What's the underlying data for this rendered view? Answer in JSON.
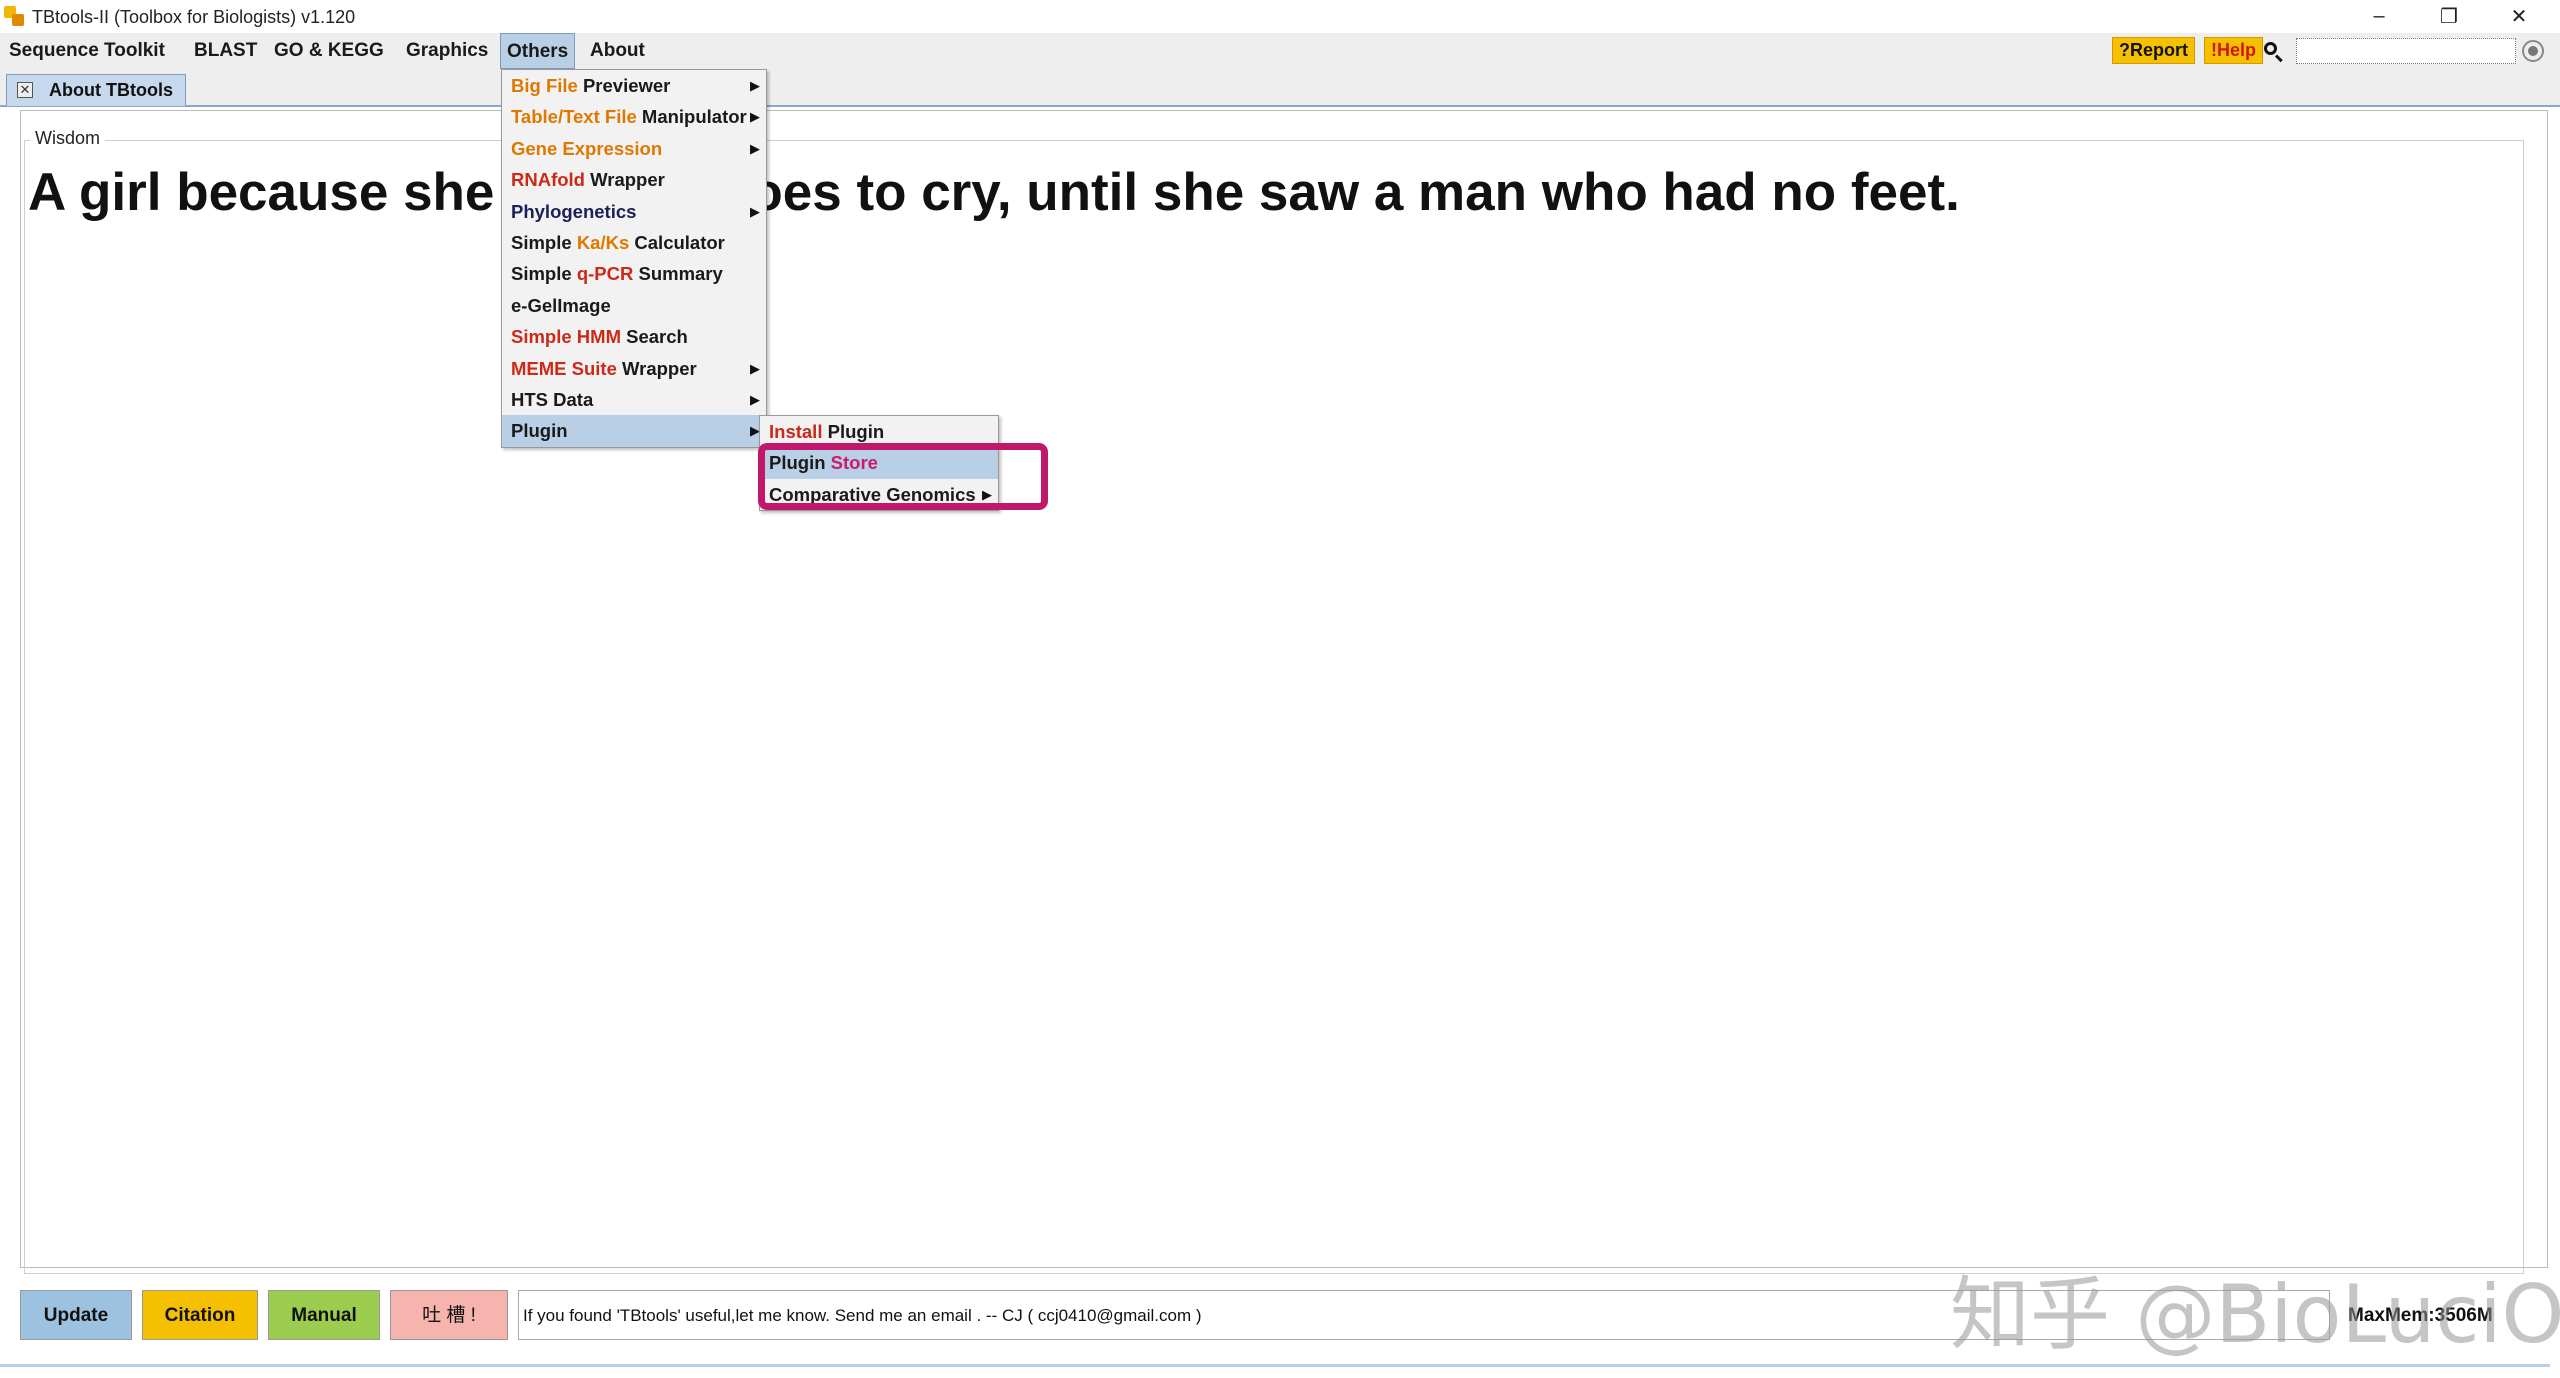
{
  "window": {
    "title": "TBtools-II (Toolbox for Biologists) v1.120",
    "controls": {
      "minimize": "–",
      "restore": "❐",
      "close": "✕"
    }
  },
  "menubar": {
    "items": [
      "Sequence Toolkit",
      "BLAST",
      "GO & KEGG",
      "Graphics",
      "Others",
      "About"
    ],
    "report_label": "?Report",
    "help_label": "!Help",
    "search_value": ""
  },
  "tab": {
    "label": "About TBtools",
    "close_glyph": "✕"
  },
  "wisdom": {
    "legend": "Wisdom",
    "quote_left": "A girl because she",
    "quote_right": "oes to cry, until she saw a man who had no feet."
  },
  "others_menu": {
    "items": [
      {
        "parts": [
          [
            "Big File",
            "orange"
          ],
          [
            " Previewer",
            ""
          ]
        ],
        "submenu": true
      },
      {
        "parts": [
          [
            "Table/Text File",
            "orange"
          ],
          [
            " Manipulator",
            ""
          ]
        ],
        "submenu": true
      },
      {
        "parts": [
          [
            "Gene Expression",
            "orange"
          ]
        ],
        "submenu": true
      },
      {
        "parts": [
          [
            "RNAfold",
            "red"
          ],
          [
            " Wrapper",
            ""
          ]
        ],
        "submenu": false
      },
      {
        "parts": [
          [
            "Phylogenetics",
            "dark"
          ]
        ],
        "submenu": true
      },
      {
        "parts": [
          [
            "Simple ",
            ""
          ],
          [
            "Ka/Ks",
            "orange"
          ],
          [
            " Calculator",
            ""
          ]
        ],
        "submenu": false
      },
      {
        "parts": [
          [
            "Simple ",
            ""
          ],
          [
            "q-PCR",
            "red"
          ],
          [
            " Summary",
            ""
          ]
        ],
        "submenu": false
      },
      {
        "parts": [
          [
            "e-GelImage",
            ""
          ]
        ],
        "submenu": false
      },
      {
        "parts": [
          [
            "Simple HMM",
            "red"
          ],
          [
            " Search",
            ""
          ]
        ],
        "submenu": false
      },
      {
        "parts": [
          [
            "MEME Suite",
            "red"
          ],
          [
            " Wrapper",
            ""
          ]
        ],
        "submenu": true
      },
      {
        "parts": [
          [
            "HTS Data",
            ""
          ]
        ],
        "submenu": true
      },
      {
        "parts": [
          [
            "Plugin",
            ""
          ]
        ],
        "submenu": true
      }
    ]
  },
  "plugin_menu": {
    "items": [
      {
        "parts": [
          [
            "Install",
            "red"
          ],
          [
            " Plugin",
            ""
          ]
        ],
        "submenu": false
      },
      {
        "parts": [
          [
            "Plugin ",
            ""
          ],
          [
            "Store",
            "magenta"
          ]
        ],
        "submenu": false
      },
      {
        "parts": [
          [
            "Comparative Genomics",
            ""
          ]
        ],
        "submenu": true
      }
    ]
  },
  "bottom": {
    "update_label": "Update",
    "citation_label": "Citation",
    "manual_label": "Manual",
    "complain_label": "吐 槽 !",
    "message": "If you found 'TBtools' useful,let me know. Send me an email . -- CJ   ( ccj0410@gmail.com )",
    "memory": "MaxMem:3506M"
  },
  "watermark": "知乎 @BioLuciO",
  "colors": {
    "accent_selected": "#b8cfe5",
    "highlight_box": "#c2186b",
    "update_btn": "#9cc2e0",
    "citation_btn": "#f5c000",
    "manual_btn": "#9ccd4f",
    "complain_btn": "#f7b4ae"
  }
}
